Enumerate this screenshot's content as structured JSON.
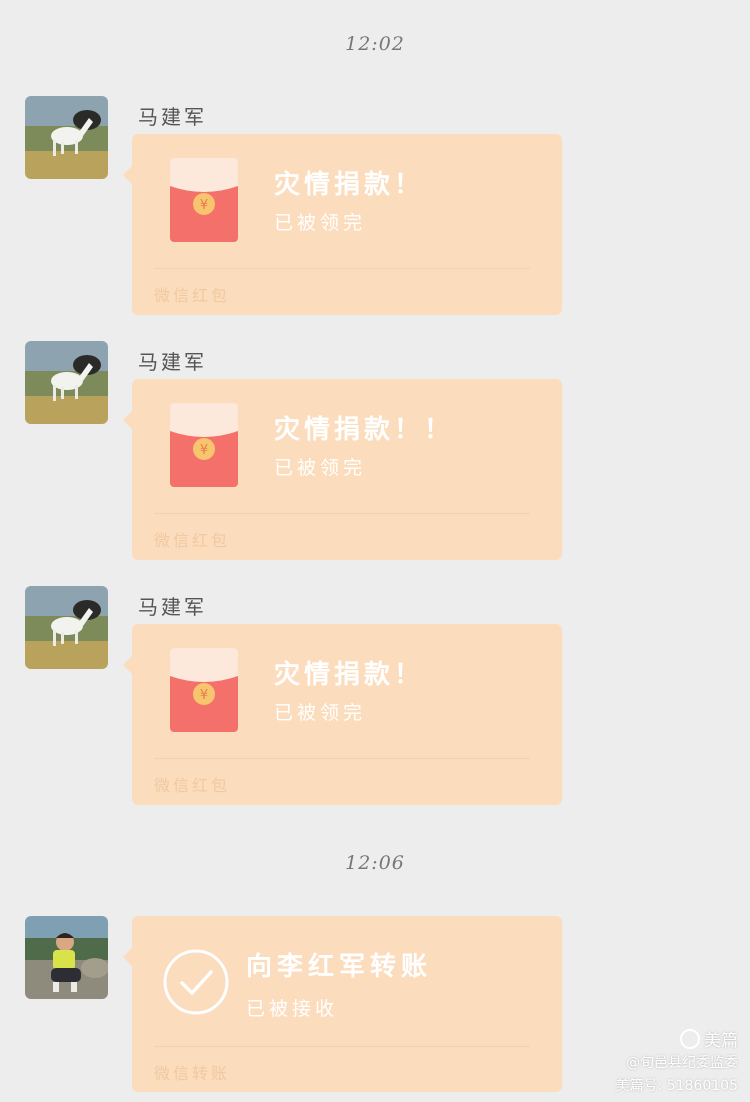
{
  "timestamps": [
    "12:02",
    "12:06"
  ],
  "messages": [
    {
      "sender": "马建军",
      "title": "灾情捐款！",
      "status": "已被领完",
      "footer": "微信红包"
    },
    {
      "sender": "马建军",
      "title": "灾情捐款！！",
      "status": "已被领完",
      "footer": "微信红包"
    },
    {
      "sender": "马建军",
      "title": "灾情捐款！",
      "status": "已被领完",
      "footer": "微信红包"
    },
    {
      "title": "向李红军转账",
      "status": "已被接收",
      "footer": "微信转账"
    }
  ],
  "watermark": {
    "brand": "美篇",
    "author": "@旬邑县纪委监委",
    "id": "美篇号: 51860105"
  },
  "colors": {
    "background": "#ededed",
    "bubble": "#fbdcbd",
    "envelope": "#f4716b",
    "coin": "#f6c56e"
  }
}
